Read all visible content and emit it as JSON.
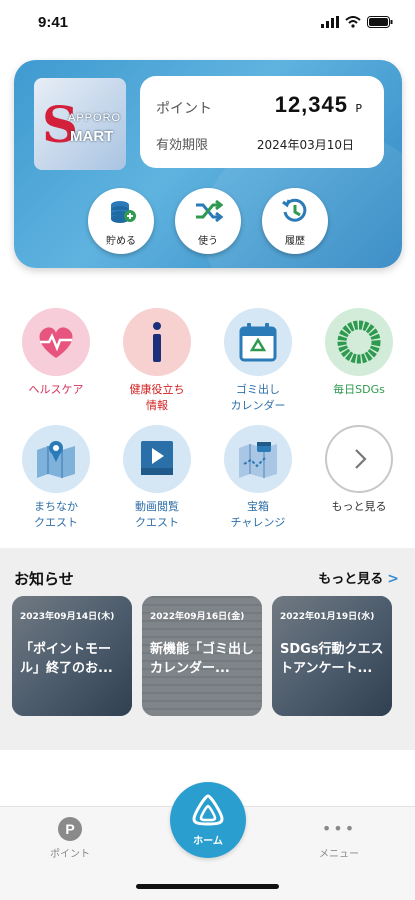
{
  "status_bar": {
    "time": "9:41"
  },
  "card": {
    "logo": {
      "s": "S",
      "apporo": "APPORO",
      "mart": "MART"
    },
    "points_label": "ポイント",
    "points_value": "12,345",
    "points_unit": "P",
    "expiry_label": "有効期限",
    "expiry_date": "2024年03月10日",
    "buttons": [
      {
        "label": "貯める",
        "icon": "coins-icon"
      },
      {
        "label": "使う",
        "icon": "shuffle-icon"
      },
      {
        "label": "履歴",
        "icon": "history-icon"
      }
    ]
  },
  "features": [
    {
      "label": "ヘルスケア",
      "icon": "heart-icon",
      "color": "#d6325a"
    },
    {
      "label": "健康役立ち\n情報",
      "icon": "info-icon",
      "color": "#d22020"
    },
    {
      "label": "ゴミ出し\nカレンダー",
      "icon": "recycle-calendar-icon",
      "color": "#2f6fa8"
    },
    {
      "label": "毎日SDGs",
      "icon": "sdgs-icon",
      "color": "#2e9a4f"
    },
    {
      "label": "まちなか\nクエスト",
      "icon": "map-icon",
      "color": "#2f6fa8"
    },
    {
      "label": "動画閲覧\nクエスト",
      "icon": "video-ad-icon",
      "color": "#2f6fa8"
    },
    {
      "label": "宝箱\nチャレンジ",
      "icon": "treasure-map-icon",
      "color": "#2f6fa8"
    },
    {
      "label": "もっと見る",
      "icon": "chevron-right-icon",
      "color": "#333333"
    }
  ],
  "news": {
    "title": "お知らせ",
    "more_label": "もっと見る",
    "items": [
      {
        "date": "2023年09月14日(木)",
        "headline": "「ポイントモール」終了のお..."
      },
      {
        "date": "2022年09月16日(金)",
        "headline": "新機能「ゴミ出しカレンダー..."
      },
      {
        "date": "2022年01月19日(水)",
        "headline": "SDGs行動クエストアンケート..."
      }
    ]
  },
  "bottom_nav": {
    "points_glyph": "P",
    "points_label": "ポイント",
    "home_label": "ホーム",
    "menu_label": "メニュー"
  }
}
